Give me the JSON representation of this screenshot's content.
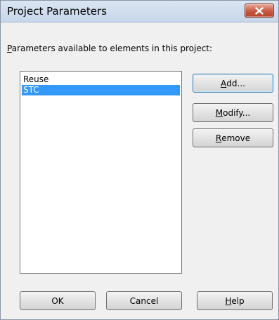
{
  "window": {
    "title": "Project Parameters",
    "close_icon": "close-x-icon"
  },
  "instruction": {
    "prefix": "P",
    "rest": "arameters available to elements in this project:"
  },
  "parameters": {
    "items": [
      {
        "label": "Reuse",
        "selected": false
      },
      {
        "label": "STC",
        "selected": true
      }
    ]
  },
  "side_buttons": {
    "add": {
      "accel": "A",
      "rest": "dd..."
    },
    "modify": {
      "accel": "M",
      "rest": "odify..."
    },
    "remove": {
      "accel": "R",
      "rest": "emove"
    }
  },
  "bottom_buttons": {
    "ok": "OK",
    "cancel": "Cancel",
    "help": {
      "accel": "H",
      "rest": "elp"
    }
  }
}
